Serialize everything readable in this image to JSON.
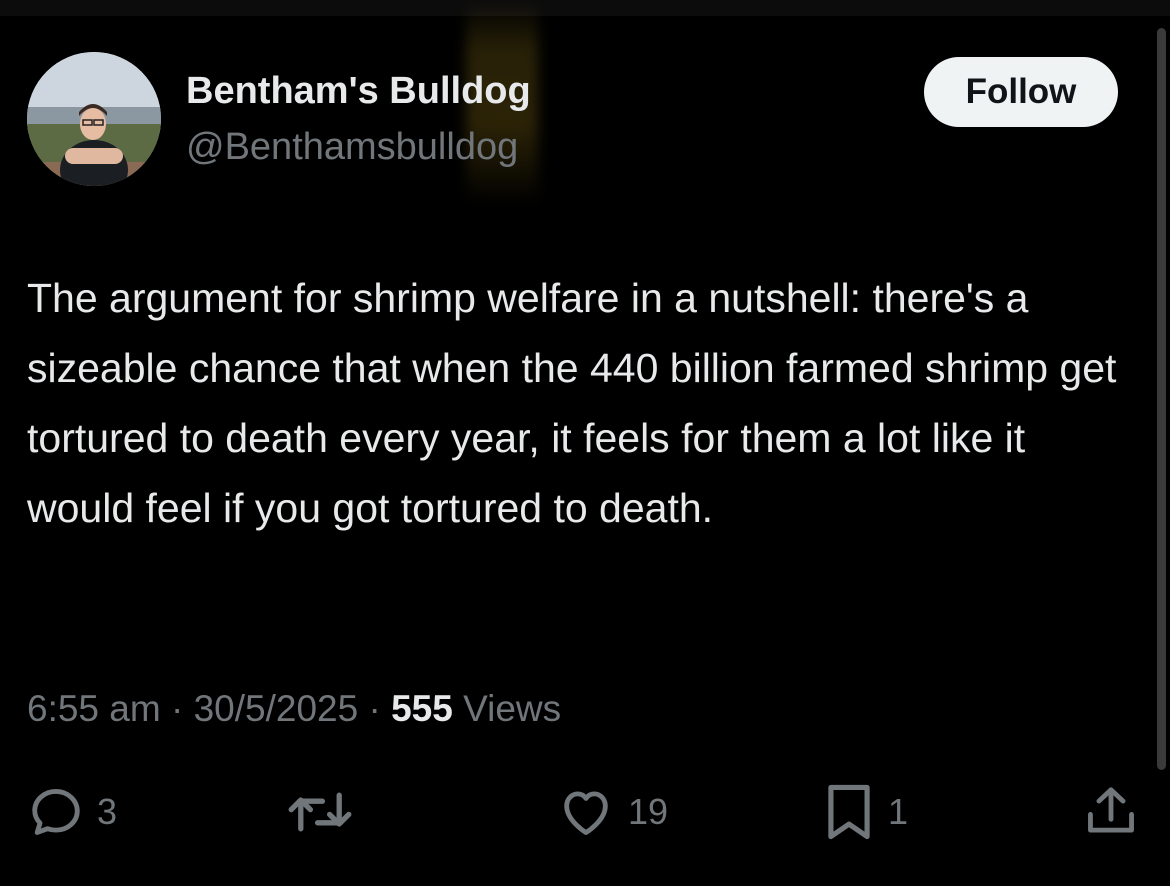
{
  "author": {
    "display_name": "Bentham's Bulldog",
    "handle": "@Benthamsbulldog",
    "avatar_icon": "profile-photo"
  },
  "follow_button": {
    "label": "Follow"
  },
  "tweet": {
    "text": "The argument for shrimp welfare in a nutshell: there's a sizeable chance that when the 440 billion farmed shrimp get tortured to death every year, it feels for them a lot like it would feel if you got tortured to death."
  },
  "meta": {
    "time": "6:55 am",
    "separator": "·",
    "date": "30/5/2025",
    "views_count": "555",
    "views_label": "Views"
  },
  "actions": {
    "reply": {
      "icon": "reply-icon",
      "count": "3"
    },
    "repost": {
      "icon": "repost-icon"
    },
    "like": {
      "icon": "heart-icon",
      "count": "19"
    },
    "bookmark": {
      "icon": "bookmark-icon",
      "count": "1"
    },
    "share": {
      "icon": "share-icon"
    }
  },
  "colors": {
    "background": "#000000",
    "primary_text": "#e7e9ea",
    "secondary_text": "#71767b",
    "follow_bg": "#eff3f4"
  }
}
